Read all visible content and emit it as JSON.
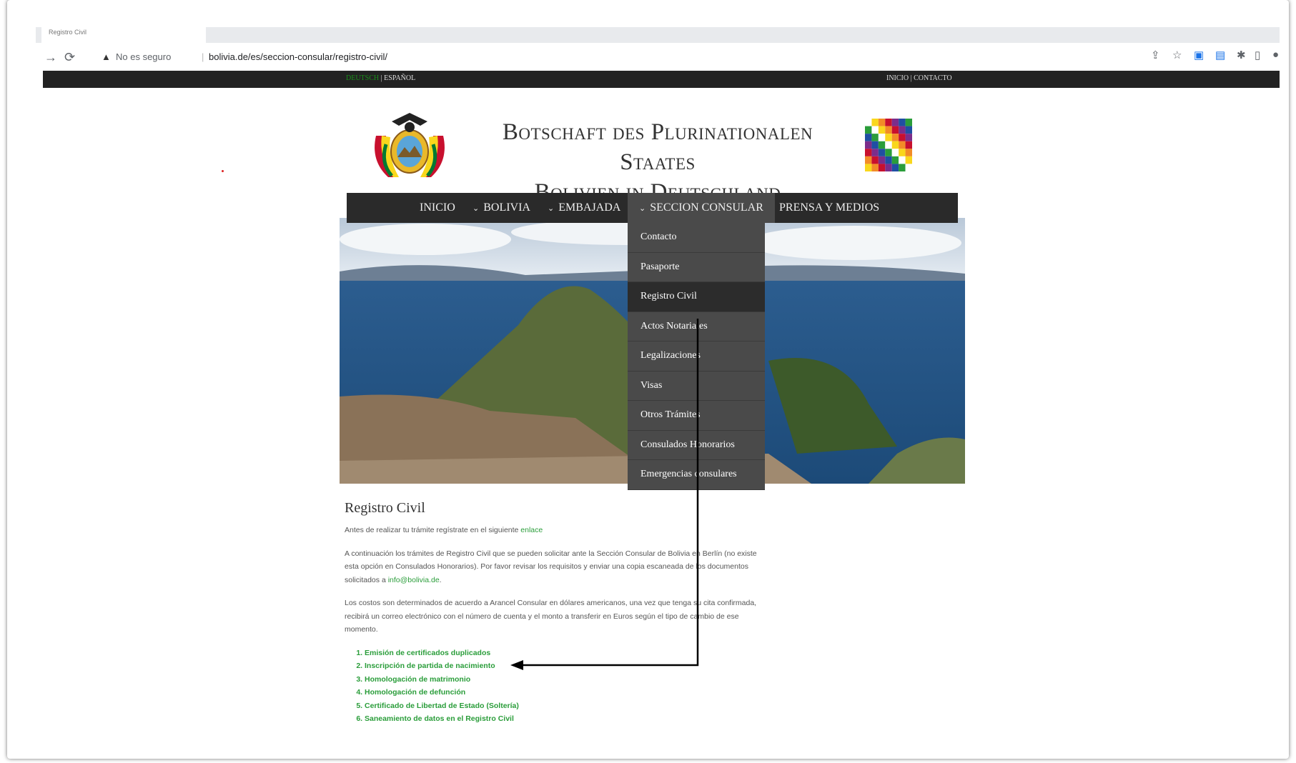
{
  "browser": {
    "tab_title": "Registro Civil",
    "security_icon": "warning-icon",
    "security_label": "No es seguro",
    "url": "bolivia.de/es/seccion-consular/registro-civil/",
    "icons": [
      "share-icon",
      "star-icon",
      "translate-icon",
      "extension-icon",
      "puzzle-icon",
      "sidepanel-icon",
      "profile-icon"
    ]
  },
  "topbar": {
    "lang_de": "DEUTSCH",
    "lang_sep": "|",
    "lang_es": "ESPAÑOL",
    "links": "INICIO | CONTACTO"
  },
  "header": {
    "title_line1": "Botschaft des Plurinationalen Staates",
    "title_line2": "Bolivien in Deutschland"
  },
  "menu": {
    "items": [
      {
        "label": "INICIO",
        "chevron": false
      },
      {
        "label": "BOLIVIA",
        "chevron": true
      },
      {
        "label": "EMBAJADA",
        "chevron": true
      },
      {
        "label": "SECCION CONSULAR",
        "chevron": true,
        "active": true
      },
      {
        "label": "PRENSA Y MEDIOS",
        "chevron": false
      }
    ],
    "dropdown": [
      "Contacto",
      "Pasaporte",
      "Registro Civil",
      "Actos Notariales",
      "Legalizaciones",
      "Visas",
      "Otros Trámites",
      "Consulados Honorarios",
      "Emergencias consulares"
    ]
  },
  "content": {
    "heading": "Registro Civil",
    "p1_text": "Antes de realizar tu trámite regístrate en el siguiente ",
    "p1_link": "enlace",
    "p2_text": "A continuación los trámites de Registro Civil que se pueden solicitar ante la Sección Consular de Bolivia en Berlín (no existe esta opción en Consulados Honorarios). Por favor revisar los requisitos y enviar una copia escaneada de los documentos solicitados a ",
    "p2_link": "info@bolivia.de",
    "p2_end": ".",
    "p3_text": "Los costos son determinados de acuerdo a Arancel Consular en dólares americanos, una vez que tenga su cita confirmada, recibirá un correo electrónico con el número de cuenta y el monto  a transferir en Euros según el tipo de cambio de ese momento.",
    "list": [
      "Emisión de certificados duplicados",
      "Inscripción de partida de nacimiento",
      "Homologación de matrimonio",
      "Homologación de defunción",
      "Certificado de Libertad de Estado (Soltería)",
      "Saneamiento de datos en el Registro Civil"
    ]
  },
  "colors": {
    "menu_bg": "#2a2a2a",
    "dropdown_bg": "#4a4a4a",
    "link_green": "#2a9d3a",
    "annotation": "#000000"
  }
}
